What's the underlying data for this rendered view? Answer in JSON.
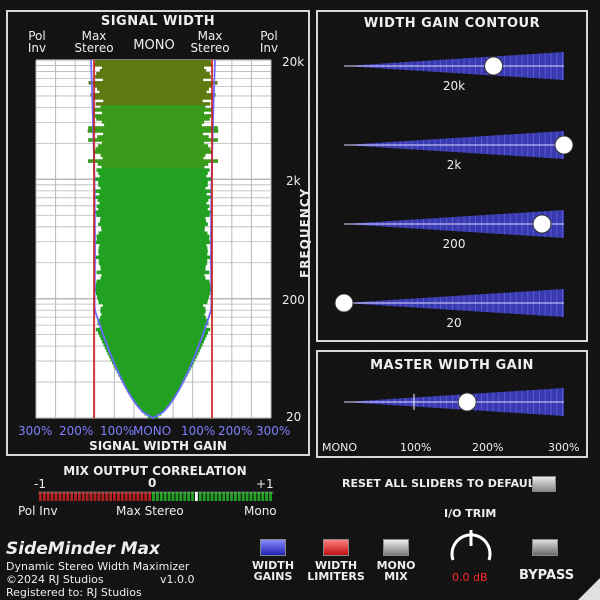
{
  "signal_width": {
    "title": "SIGNAL WIDTH",
    "header_left_polinv": "Pol\nInv",
    "header_max_stereo_left": "Max\nStereo",
    "header_mono": "MONO",
    "header_max_stereo_right": "Max\nStereo",
    "header_polinv_right": "Pol\nInv",
    "freq_labels": [
      "20k",
      "2k",
      "200",
      "20"
    ],
    "freq_axis_label": "FREQUENCY",
    "width_labels": [
      "300%",
      "200%",
      "100%",
      "MONO",
      "100%",
      "200%",
      "300%"
    ],
    "footer": "SIGNAL WIDTH GAIN"
  },
  "contour": {
    "title": "WIDTH GAIN CONTOUR",
    "sliders": [
      {
        "label": "20k",
        "value": 0.68
      },
      {
        "label": "2k",
        "value": 1.0
      },
      {
        "label": "200",
        "value": 0.9
      },
      {
        "label": "20",
        "value": 0.0
      }
    ]
  },
  "master": {
    "title": "MASTER WIDTH GAIN",
    "scale": [
      "MONO",
      "100%",
      "200%",
      "300%"
    ],
    "value": 0.56
  },
  "mix": {
    "title": "MIX OUTPUT CORRELATION",
    "ticks": [
      "-1",
      "0",
      "+1"
    ],
    "labels": [
      "Pol Inv",
      "Max Stereo",
      "Mono"
    ]
  },
  "reset": {
    "label": "RESET ALL SLIDERS TO DEFAULT"
  },
  "trim": {
    "label": "I/O TRIM",
    "value": "0.0 dB"
  },
  "product": {
    "name": "SideMinder Max",
    "subtitle": "Dynamic Stereo Width Maximizer",
    "copyright": "©2024 RJ Studios",
    "version": "v1.0.0",
    "registered": "Registered to: RJ Studios"
  },
  "buttons": {
    "width_gains": "WIDTH\nGAINS",
    "width_limiters": "WIDTH\nLIMITERS",
    "mono_mix": "MONO\nMIX",
    "bypass": "BYPASS"
  },
  "colors": {
    "accent_blue": "#3a3ab0",
    "limit_red": "#d01818",
    "meter_green": "#22aa22",
    "trim_red": "#ff2a2a"
  }
}
